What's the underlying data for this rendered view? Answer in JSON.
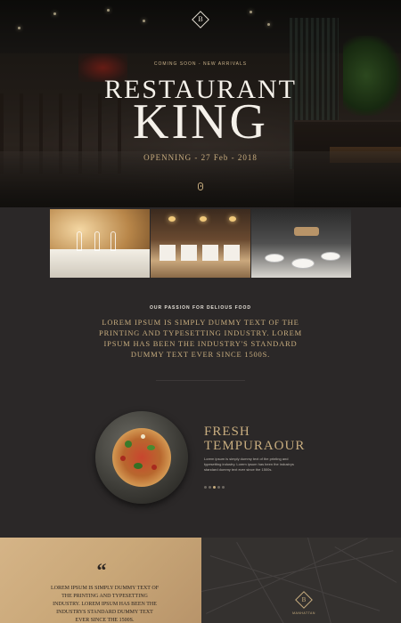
{
  "hero": {
    "logo_letter": "B",
    "coming_soon": "COMING SOON - NEW ARRIVALS",
    "title_line1": "RESTAURANT",
    "title_line2": "KING",
    "opening": "OPENNING - 27 Feb - 2018",
    "scroll_icon": "mouse-scroll-icon"
  },
  "gallery": {
    "images": [
      "dining-table-photo",
      "restaurant-interior-photo",
      "dessert-table-photo"
    ]
  },
  "passion": {
    "label": "OUR PASSION FOR DELIOUS FOOD",
    "text": "Lorem Ipsum is simply dummy text of the printing and typesetting industry. Lorem Ipsum has been the industry's standard dummy text ever since 1500s."
  },
  "feature": {
    "title": "FRESH TEMPURAOUR",
    "description": "Lorem ipsum is simply dummy text of the printing and typesetting industry. Lorem ipsum has been the industrys standard dummy text ever since the 1500s.",
    "slides": 5,
    "active_slide": 3
  },
  "testimonial": {
    "quote_mark": "“",
    "text": "Lorem Ipsum is simply dummy text of the printing and typesetting industry. Lorem Ipsum has been the industrys standard dummy text ever since the 1500s."
  },
  "map": {
    "marker_letter": "B",
    "label": "MANHATTAN"
  },
  "colors": {
    "background": "#2b2828",
    "accent_gold": "#c8ad7f",
    "quote_panel": "#cfae80"
  }
}
